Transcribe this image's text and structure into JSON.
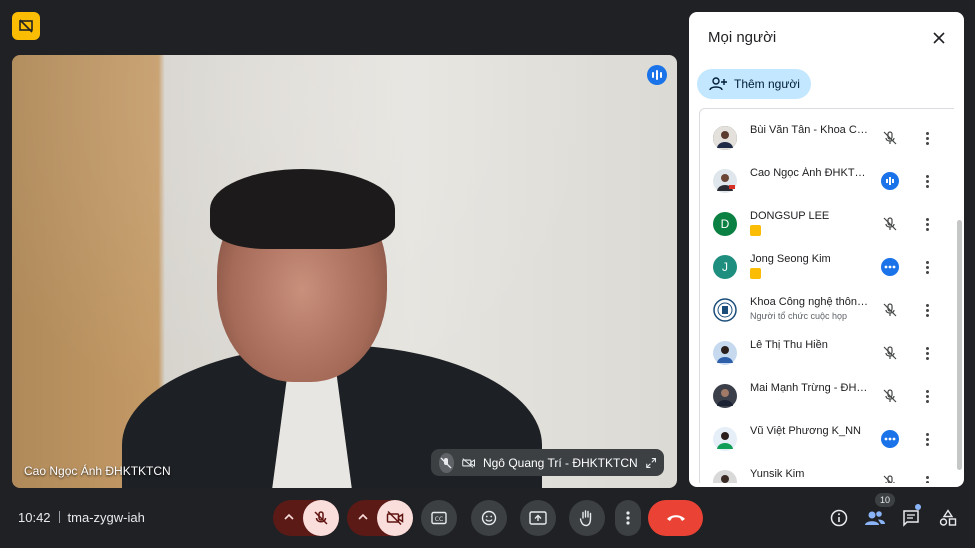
{
  "colors": {
    "background": "#202124",
    "accent": "#1a73e8",
    "end_call": "#ea4335",
    "warning_badge": "#fbbc04"
  },
  "main_video": {
    "participant_name": "Cao Ngọc Ánh ĐHKTKTCN"
  },
  "pip": {
    "participant_name": "Ngô Quang Trí - ĐHKTKTCN"
  },
  "people_panel": {
    "title": "Mọi người",
    "add_button_label": "Thêm người",
    "participants": [
      {
        "name": "Bùi Văn Tân - Khoa CNTT",
        "avatar_type": "photo",
        "status": "muted"
      },
      {
        "name": "Cao Ngọc Ánh ĐHKTKTCN",
        "avatar_type": "photo",
        "status": "speaking"
      },
      {
        "name": "DONGSUP LEE",
        "initial": "D",
        "avatar_color": "#0b8043",
        "status": "muted",
        "badge": true
      },
      {
        "name": "Jong Seong Kim",
        "initial": "J",
        "avatar_color": "#1e8e7e",
        "status": "more",
        "badge": true
      },
      {
        "name": "Khoa Công nghệ thông tin",
        "subtitle": "Người tổ chức cuộc họp",
        "avatar_type": "logo",
        "status": "muted"
      },
      {
        "name": "Lê Thị Thu Hiền",
        "avatar_type": "photo",
        "status": "muted"
      },
      {
        "name": "Mai Mạnh Trừng - ĐHKTKTCN",
        "avatar_type": "photo",
        "status": "muted"
      },
      {
        "name": "Vũ Việt Phương K_NN",
        "avatar_type": "photo",
        "status": "more"
      },
      {
        "name": "Yunsik Kim",
        "avatar_type": "photo",
        "status": "muted",
        "badge": true
      }
    ]
  },
  "bottom_bar": {
    "time": "10:42",
    "meeting_code": "tma-zygw-iah",
    "participant_count": "10"
  }
}
